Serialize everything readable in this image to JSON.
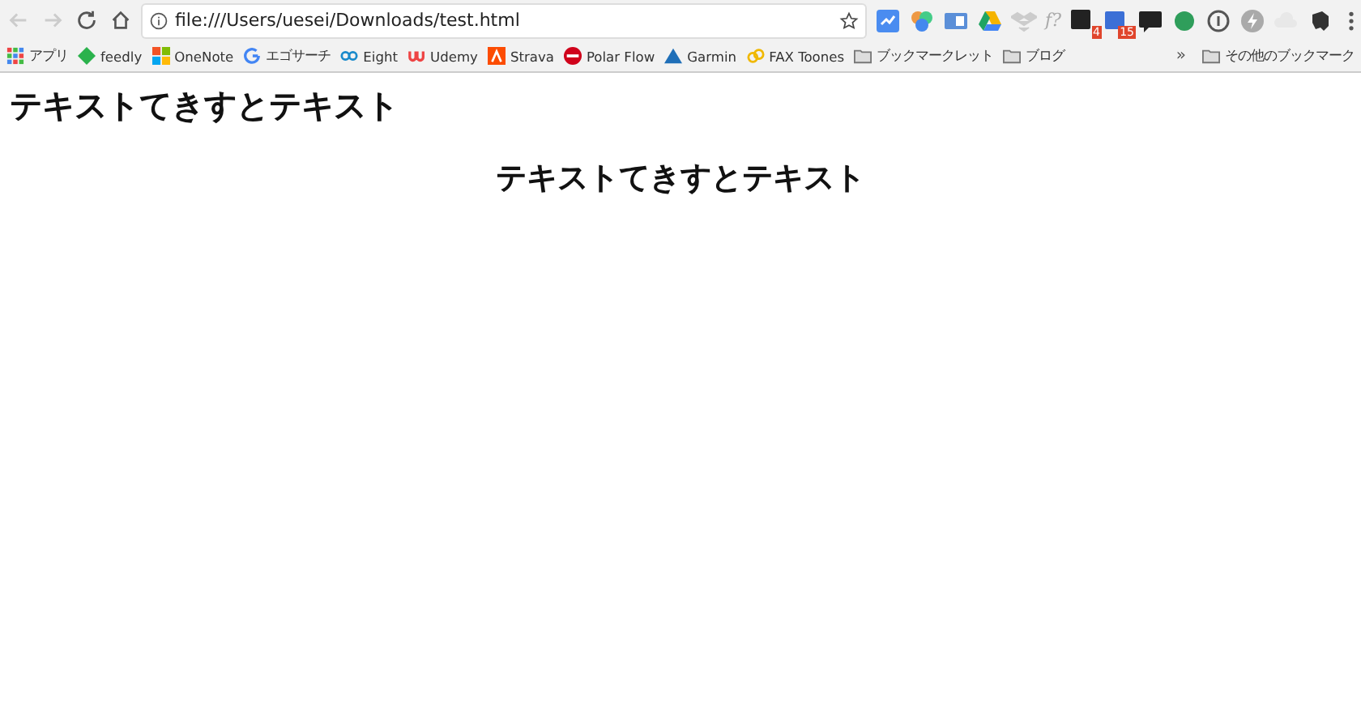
{
  "address_bar": {
    "url": "file:///Users/uesei/Downloads/test.html"
  },
  "extensions": [
    {
      "kind": "chart"
    },
    {
      "kind": "wheel"
    },
    {
      "kind": "card"
    },
    {
      "kind": "drive"
    },
    {
      "kind": "dropbox"
    },
    {
      "kind": "formula",
      "label": "f?"
    },
    {
      "kind": "amazon",
      "badge": "4"
    },
    {
      "kind": "calendar",
      "badge": "15"
    },
    {
      "kind": "bubble"
    },
    {
      "kind": "dot"
    },
    {
      "kind": "info"
    },
    {
      "kind": "bolt"
    },
    {
      "kind": "cloud"
    },
    {
      "kind": "elephant"
    }
  ],
  "bookmarks": [
    {
      "kind": "apps",
      "label": "アプリ"
    },
    {
      "kind": "feedly",
      "label": "feedly"
    },
    {
      "kind": "windows",
      "label": "OneNote"
    },
    {
      "kind": "google",
      "label": "エゴサーチ"
    },
    {
      "kind": "link",
      "label": "Eight"
    },
    {
      "kind": "udemy",
      "label": "Udemy"
    },
    {
      "kind": "strava",
      "label": "Strava"
    },
    {
      "kind": "polar",
      "label": "Polar Flow"
    },
    {
      "kind": "garmin",
      "label": "Garmin"
    },
    {
      "kind": "fax",
      "label": "FAX Toones"
    },
    {
      "kind": "folder",
      "label": "ブックマークレット"
    },
    {
      "kind": "folder",
      "label": "ブログ"
    }
  ],
  "bookmarks_overflow": "»",
  "other_bookmarks": "その他のブックマーク",
  "page": {
    "heading": "テキストてきすとテキスト",
    "centered_heading": "テキストてきすとテキスト"
  }
}
